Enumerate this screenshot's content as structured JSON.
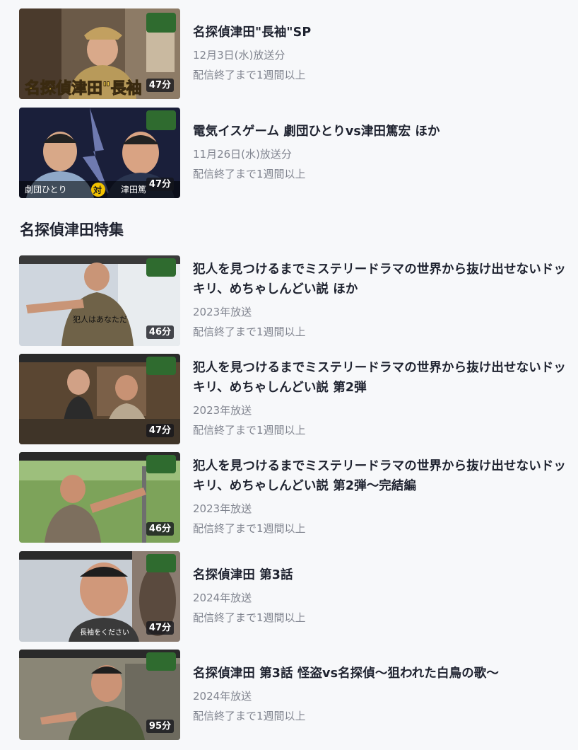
{
  "top_episodes": [
    {
      "title": "名探偵津田\"長袖\"SP",
      "broadcast": "12月3日(水)放送分",
      "availability": "配信終了まで1週間以上",
      "duration": "47分",
      "thumb_caption": "名探偵津田\"長袖"
    },
    {
      "title": "電気イスゲーム 劇団ひとりvs津田篤宏 ほか",
      "broadcast": "11月26日(水)放送分",
      "availability": "配信終了まで1週間以上",
      "duration": "47分",
      "thumb_caption_left": "劇団ひとり",
      "thumb_caption_mid": "対",
      "thumb_caption_right": "津田篤"
    }
  ],
  "section": {
    "title": "名探偵津田特集"
  },
  "special_episodes": [
    {
      "title": "犯人を見つけるまでミステリードラマの世界から抜け出せないドッキリ、めちゃしんどい説 ほか",
      "broadcast": "2023年放送",
      "availability": "配信終了まで1週間以上",
      "duration": "46分",
      "thumb_caption": "犯人はあなただ"
    },
    {
      "title": "犯人を見つけるまでミステリードラマの世界から抜け出せないドッキリ、めちゃしんどい説 第2弾",
      "broadcast": "2023年放送",
      "availability": "配信終了まで1週間以上",
      "duration": "47分"
    },
    {
      "title": "犯人を見つけるまでミステリードラマの世界から抜け出せないドッキリ、めちゃしんどい説 第2弾〜完結編",
      "broadcast": "2023年放送",
      "availability": "配信終了まで1週間以上",
      "duration": "46分"
    },
    {
      "title": "名探偵津田 第3話",
      "broadcast": "2024年放送",
      "availability": "配信終了まで1週間以上",
      "duration": "47分",
      "thumb_caption": "長袖をください"
    },
    {
      "title": "名探偵津田 第3話 怪盗vs名探偵〜狙われた白鳥の歌〜",
      "broadcast": "2024年放送",
      "availability": "配信終了まで1週間以上",
      "duration": "95分"
    }
  ]
}
